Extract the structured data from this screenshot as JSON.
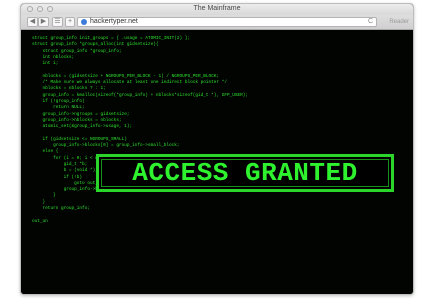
{
  "window": {
    "title": "The Mainframe"
  },
  "toolbar": {
    "back_label": "◀",
    "forward_label": "▶",
    "sidebar_label": "☰",
    "add_label": "+",
    "url": "hackertyper.net",
    "reload_label": "C",
    "reader_label": "Reader"
  },
  "terminal": {
    "code": "struct group_info init_groups = { .usage = ATOMIC_INIT(2) };\nstruct group_info *groups_alloc(int gidsetsize){\n    struct group_info *group_info;\n    int nblocks;\n    int i;\n\n    nblocks = (gidsetsize + NGROUPS_PER_BLOCK - 1) / NGROUPS_PER_BLOCK;\n    /* Make sure we always allocate at least one indirect block pointer */\n    nblocks = nblocks ? : 1;\n    group_info = kmalloc(sizeof(*group_info) + nblocks*sizeof(gid_t *), GFP_USER);\n    if (!group_info)\n        return NULL;\n    group_info->ngroups = gidsetsize;\n    group_info->nblocks = nblocks;\n    atomic_set(&group_info->usage, 1);\n\n    if (gidsetsize <= NGROUPS_SMALL)\n        group_info->blocks[0] = group_info->small_block;\n    else {\n        for (i = 0; i < nblocks; i++) {\n            gid_t *b;\n            b = (void *)__get_free_page(GFP_USER);\n            if (!b)\n                goto out_undo_partial_alloc;\n            group_info->blocks[i] = b;\n        }\n    }\n    return group_info;\n\nout_un",
    "banner": "ACCESS GRANTED"
  }
}
